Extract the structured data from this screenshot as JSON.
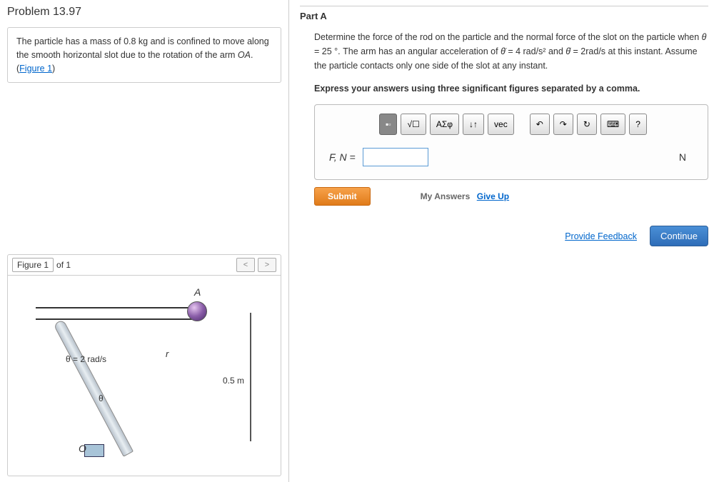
{
  "problem": {
    "title": "Problem 13.97",
    "statement_prefix": "The particle has a mass of 0.8 ",
    "unit_kg": "kg",
    "statement_mid": " and is confined to move along the smooth horizontal slot due to the rotation of the arm ",
    "arm": "OA",
    "statement_suffix": ". (",
    "figure_link": "Figure 1",
    "statement_end": ")"
  },
  "figure": {
    "label": "Figure 1",
    "of": "of 1",
    "prev": "<",
    "next": ">",
    "A": "A",
    "O": "O",
    "r": "r",
    "theta": "θ",
    "thetadot": "θ̇ = 2 rad/s",
    "dim": "0.5 m"
  },
  "part": {
    "title": "Part A",
    "q1": "Determine the force of the rod on the particle and the normal force of the slot on the particle when ",
    "q_theta": "θ",
    "q_eq": " = 25 °",
    "q2": ". The arm has an angular acceleration of ",
    "q_tdd": "θ̈",
    "q_tdd_val": " = 4 rad/s²",
    "q_and": " and ",
    "q_td": "θ̇",
    "q_td_val": " = 2rad/s",
    "q3": " at this instant. Assume the particle contacts only one side of the slot at any instant.",
    "express": "Express your answers using three significant figures separated by a comma."
  },
  "toolbar": {
    "sqrt": "√☐",
    "greek": "ΑΣφ",
    "updown": "↓↑",
    "vec": "vec",
    "undo": "↶",
    "redo": "↷",
    "reset": "↻",
    "keyboard": "⌨",
    "help": "?"
  },
  "answer": {
    "label": "F, N = ",
    "value": "",
    "unit": "N"
  },
  "actions": {
    "submit": "Submit",
    "my_answers": "My Answers",
    "giveup": "Give Up",
    "feedback": "Provide Feedback",
    "continue": "Continue"
  }
}
